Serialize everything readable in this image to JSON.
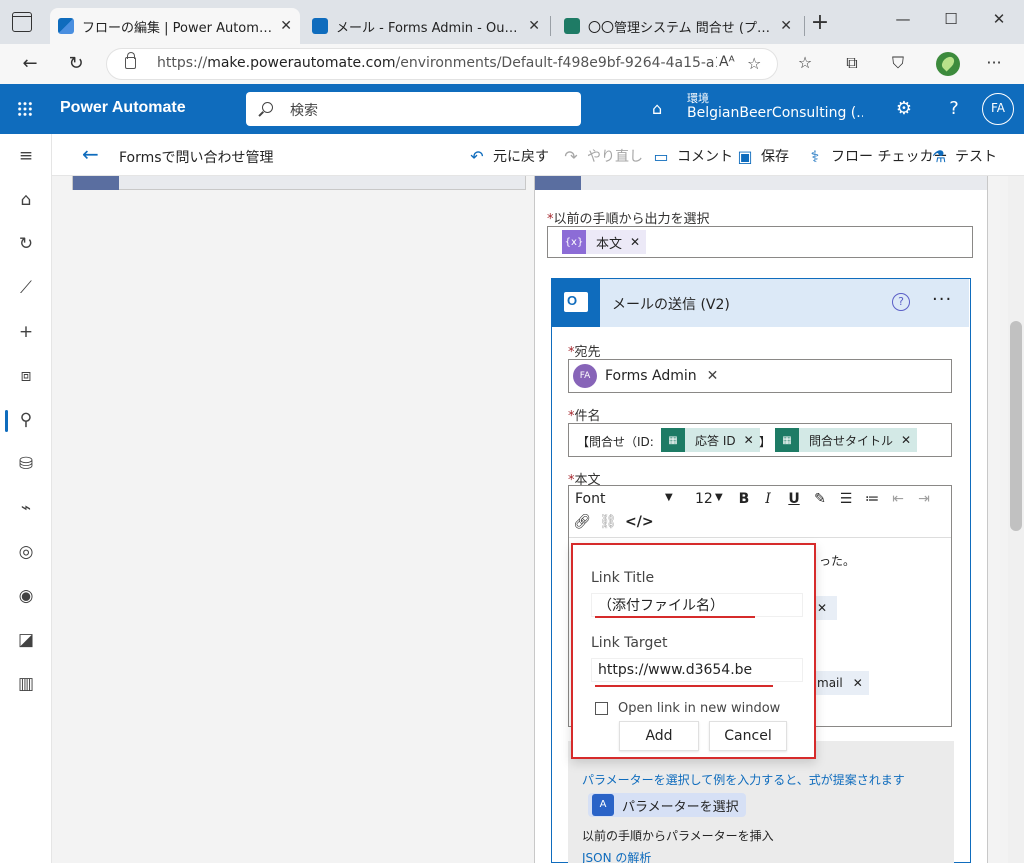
{
  "browser": {
    "tabs": [
      {
        "title": "フローの編集 | Power Automate",
        "active": true
      },
      {
        "title": "メール - Forms Admin - Outlook",
        "active": false
      },
      {
        "title": "〇〇管理システム 問合せ (プレビュー)",
        "active": false
      }
    ],
    "url_prefix": "https://",
    "url_host": "make.powerautomate.com",
    "url_rest": "/environments/Default-f498e9bf-9264-4a15-a1...",
    "reader_label": "Aᴬ"
  },
  "app": {
    "brand": "Power Automate",
    "search_placeholder": "検索",
    "env_label": "環境",
    "env_name": "BelgianBeerConsulting (...",
    "avatar_initials": "FA"
  },
  "commandbar": {
    "flow_name": "Formsで問い合わせ管理",
    "undo": "元に戻す",
    "redo": "やり直し",
    "comment": "コメント",
    "save": "保存",
    "checker": "フロー チェッカー",
    "test": "テスト"
  },
  "apply_each": {
    "label": "以前の手順から出力を選択",
    "token": "本文"
  },
  "email_action": {
    "title": "メールの送信 (V2)",
    "to_label": "宛先",
    "to_person": {
      "initials": "FA",
      "name": "Forms Admin"
    },
    "subject_label": "件名",
    "subject_prefix": "【問合せ（ID:",
    "subject_token1": "応答 ID",
    "subject_mid": "】",
    "subject_token2": "問合せタイトル",
    "body_label": "本文",
    "font_label": "Font",
    "font_size": "12",
    "body_frag1": "った。",
    "body_frag2": "mail",
    "dyn_hint": "パラメーターを選択して例を入力すると、式が提案されます",
    "param_button": "パラメーターを選択",
    "dyn_sub": "以前の手順からパラメーターを挿入",
    "dyn_link": "JSON の解析"
  },
  "link_dialog": {
    "title_label": "Link Title",
    "title_value": "（添付ファイル名）",
    "target_label": "Link Target",
    "target_value": "https://www.d3654.be",
    "new_window_label": "Open link in new window",
    "add_label": "Add",
    "cancel_label": "Cancel"
  },
  "colors": {
    "header_blue": "#0f6cbd",
    "highlight_red": "#d62b2b"
  }
}
